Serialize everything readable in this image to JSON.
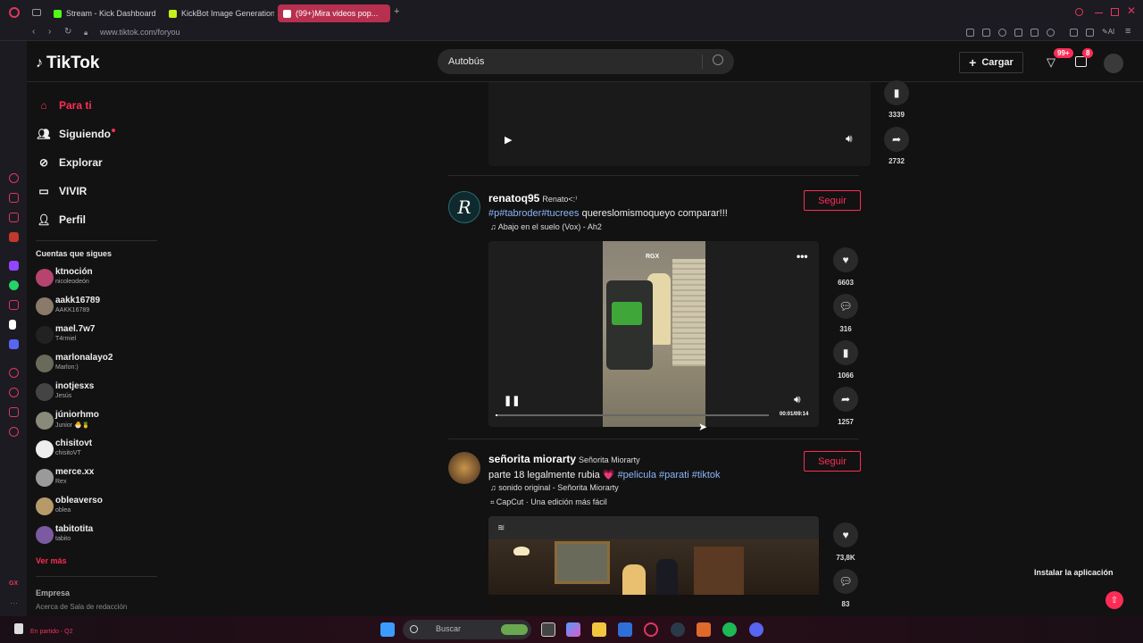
{
  "browser": {
    "tabs": [
      {
        "label": "Stream - Kick Dashboard",
        "favicon_color": "#53fc18"
      },
      {
        "label": "KickBot Image Generation",
        "favicon_color": "#c6f01b"
      },
      {
        "label": "(99+)Mira videos pop...",
        "favicon_color": "#ffffff"
      }
    ],
    "url": "www.tiktok.com/foryou"
  },
  "header": {
    "logo": "TikTok",
    "search_value": "Autobús",
    "upload_label": "Cargar",
    "inbox_badge": "99+",
    "messages_badge": "8"
  },
  "sidebar": {
    "nav": [
      {
        "label": "Para ti",
        "icon": "home-icon",
        "active": true
      },
      {
        "label": "Siguiendo",
        "icon": "following-icon"
      },
      {
        "label": "Explorar",
        "icon": "compass-icon"
      },
      {
        "label": "VIVIR",
        "icon": "live-icon"
      },
      {
        "label": "Perfil",
        "icon": "profile-icon"
      }
    ],
    "following_title": "Cuentas que sigues",
    "accounts": [
      {
        "user": "ktnoción",
        "name": "nicoleodeón",
        "color": "#b5446e"
      },
      {
        "user": "aakk16789",
        "name": "AAKK16789",
        "color": "#8a7a6a"
      },
      {
        "user": "mael.7w7",
        "name": "T4rmiel",
        "color": "#222222"
      },
      {
        "user": "marlonalayo2",
        "name": "Marlon:)",
        "color": "#6a6a5a"
      },
      {
        "user": "inotjesxs",
        "name": "Jesús",
        "color": "#444444"
      },
      {
        "user": "júniorhmo",
        "name": "Junior 🐣🍍",
        "color": "#8a8a7a"
      },
      {
        "user": "chisitovt",
        "name": "chisitoVT",
        "color": "#eeeeee"
      },
      {
        "user": "merce.xx",
        "name": "Rex",
        "color": "#9a9a9a"
      },
      {
        "user": "obleaverso",
        "name": "oblea",
        "color": "#b89a6a"
      },
      {
        "user": "tabitotita",
        "name": "tabito",
        "color": "#7a5aa0"
      }
    ],
    "see_more": "Ver más",
    "company": "Empresa",
    "footer_links": "Acerca de  Sala de redacción"
  },
  "feed": {
    "top_video": {
      "save_count": "3339",
      "share_count": "2732"
    },
    "post1": {
      "username": "renatoq95",
      "nickname": "Renato<:⁾",
      "hashtags": "#p#tabroder#tucrees",
      "caption": " quereslomismoqueyo comparar!!!",
      "music": "♫ Abajo en el suelo (Vox) - Ah2",
      "follow_label": "Seguir",
      "watermark": "RGX",
      "time": "00:01/09:14",
      "likes": "6603",
      "comments": "316",
      "saves": "1066",
      "shares": "1257"
    },
    "post2": {
      "username": "señorita miorarty",
      "nickname": "Señorita Miorarty",
      "caption": "parte 18 legalmente rubia 💗 ",
      "hashtags": "#pelicula #parati #tiktok",
      "music": "♫ sonido original - Señorita Miorarty",
      "capcut": "CapCut · Una edición más fácil",
      "follow_label": "Seguir",
      "likes": "73,8K",
      "comments": "83"
    }
  },
  "install_label": "Instalar la aplicación",
  "taskbar": {
    "search_placeholder": "Buscar",
    "left_status": "En partido - Q2"
  }
}
